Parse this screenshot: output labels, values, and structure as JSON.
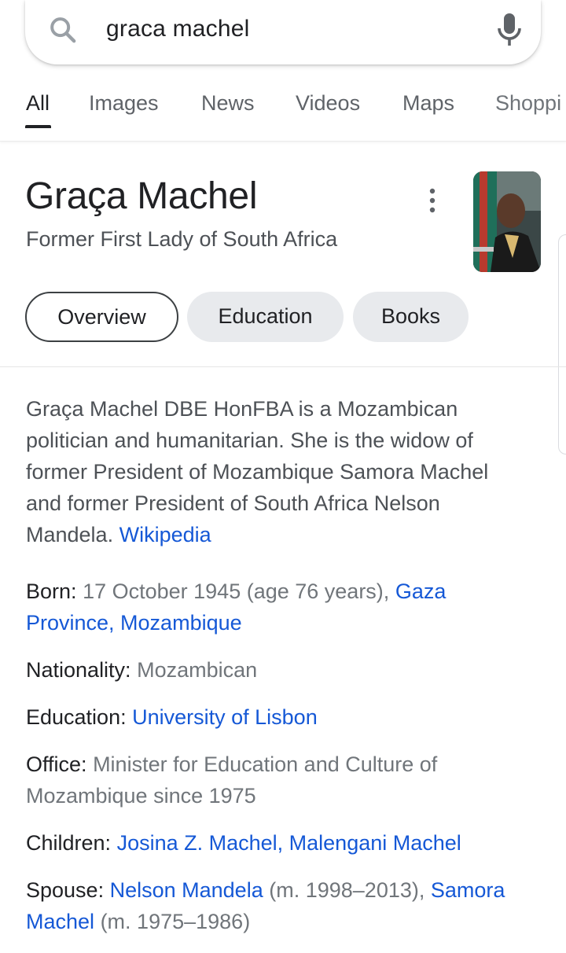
{
  "search": {
    "query": "graca machel"
  },
  "tabs": [
    {
      "label": "All"
    },
    {
      "label": "Images"
    },
    {
      "label": "News"
    },
    {
      "label": "Videos"
    },
    {
      "label": "Maps"
    },
    {
      "label": "Shoppi"
    }
  ],
  "panel": {
    "title": "Graça Machel",
    "subtitle": "Former First Lady of South Africa",
    "chips": [
      "Overview",
      "Education",
      "Books"
    ],
    "description": "Graça Machel DBE HonFBA is a Mozambican politician and humanitarian. She is the widow of former President of Mozambique Samora Machel and former President of South Africa Nelson Mandela.",
    "source": "Wikipedia"
  },
  "facts": {
    "born": {
      "key": "Born:",
      "text": "17 October 1945 (age 76 years),",
      "link": "Gaza Province, Mozambique"
    },
    "nationality": {
      "key": "Nationality:",
      "text": "Mozambican"
    },
    "education": {
      "key": "Education:",
      "link": "University of Lisbon"
    },
    "office": {
      "key": "Office:",
      "text": "Minister for Education and Culture of Mozambique since 1975"
    },
    "children": {
      "key": "Children:",
      "link": "Josina Z. Machel, Malengani Machel"
    },
    "spouse": {
      "key": "Spouse:",
      "link1": "Nelson Mandela",
      "text1": "(m. 1998–2013),",
      "link2": "Samora Machel",
      "text2": "(m. 1975–1986)"
    }
  },
  "colors": {
    "link": "#1558d6",
    "chip_bg": "#e8eaed",
    "text": "#202124",
    "muted": "#70757a"
  },
  "icons": [
    "search-icon",
    "microphone-icon",
    "more-vert-icon"
  ]
}
